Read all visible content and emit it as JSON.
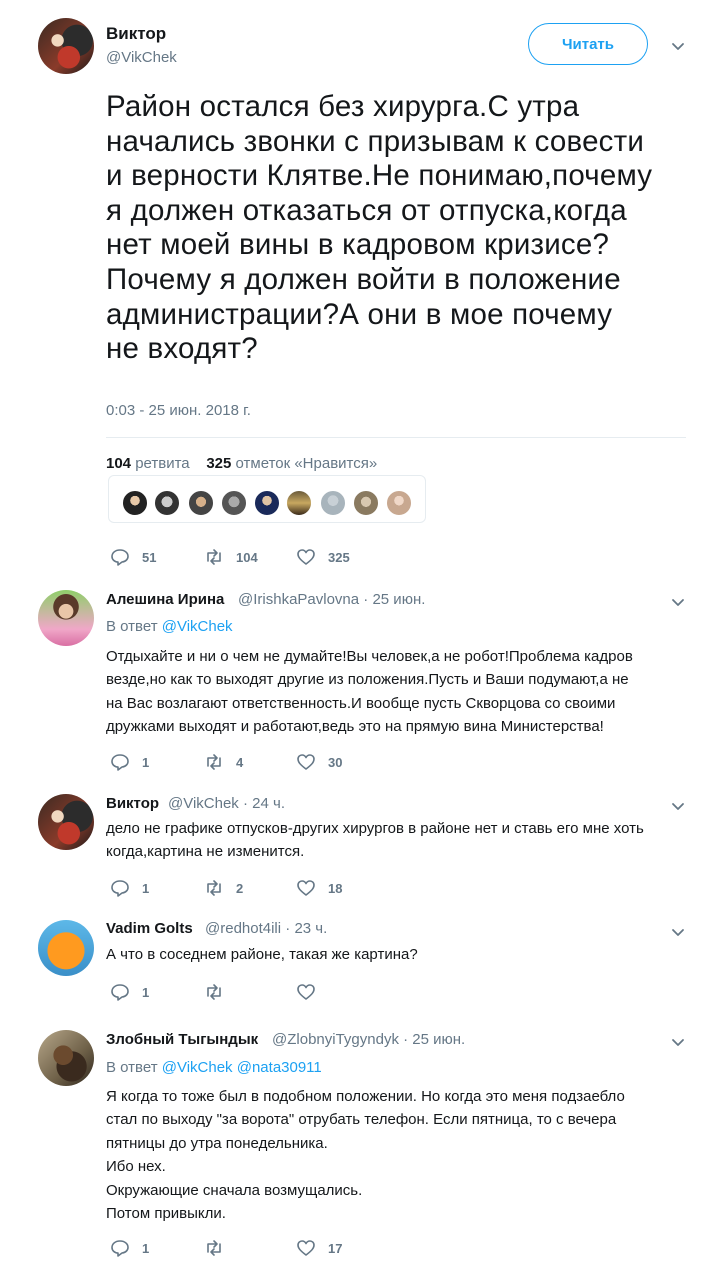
{
  "main_tweet": {
    "author_name": "Виктор",
    "author_handle": "@VikChek",
    "follow_label": "Читать",
    "text": "Район остался без хирурга.С утра\nначались звонки с призывам к совести\nи верности Клятве.Не понимаю,почему\nя должен отказаться от отпуска,когда\nнет моей вины в кадровом кризисе?\nПочему я должен войти в положение\nадминистрации?А они в мое почему\nне входят?",
    "timestamp": "0:03 - 25 июн. 2018 г.",
    "retweets_count": "104",
    "retweets_label": "ретвита",
    "likes_count": "325",
    "likes_label": "отметок «Нравится»",
    "actions": {
      "replies": "51",
      "retweets": "104",
      "likes": "325"
    }
  },
  "replies": [
    {
      "name": "Алешина Ирина",
      "handle": "@IrishkaPavlovna",
      "time": "· 25 июн.",
      "reply_prefix": "В ответ",
      "reply_to": "@VikChek",
      "text": "Отдыхайте и ни о чем не думайте!Вы человек,а не робот!Проблема кадров\nвезде,но как то выходят другие из положения.Пусть и Ваши подумают,а не\nна Вас возлагают ответственность.И вообще пусть Скворцова со своими\nдружками выходят и работают,ведь это на прямую вина Министерства!",
      "replies": "1",
      "retweets": "4",
      "likes": "30"
    },
    {
      "name": "Виктор",
      "handle": "@VikChek",
      "time": "· 24 ч.",
      "text": "дело не графике отпусков-других хирургов в районе нет и ставь его мне хоть\nкогда,картина не изменится.",
      "replies": "1",
      "retweets": "2",
      "likes": "18"
    },
    {
      "name": "Vadim Golts",
      "handle": "@redhot4ili",
      "time": "· 23 ч.",
      "text": "А что в соседнем районе, такая же картина?",
      "replies": "1",
      "retweets": "",
      "likes": ""
    },
    {
      "name": "Злобный Тыгындык",
      "handle": "@ZlobnyiTygyndyk",
      "time": "· 25 июн.",
      "reply_prefix": "В ответ",
      "reply_to": "@VikChek",
      "reply_to_2": "@nata30911",
      "text": "Я когда то тоже был в подобном положении. Но когда это меня подзаебло\nстал по выходу \"за ворота\" отрубать телефон. Если пятница, то с вечера\nпятницы до утра понедельника.\nИбо нех.\nОкружающие сначала возмущались.\nПотом привыкли.",
      "replies": "1",
      "retweets": "",
      "likes": "17"
    }
  ],
  "colors": {
    "accent": "#1da1f2",
    "secondary_text": "#657786",
    "text": "#14171a",
    "divider": "#e6ecf0"
  },
  "icons": [
    "chevron-down-icon",
    "reply-icon",
    "retweet-icon",
    "like-icon"
  ]
}
